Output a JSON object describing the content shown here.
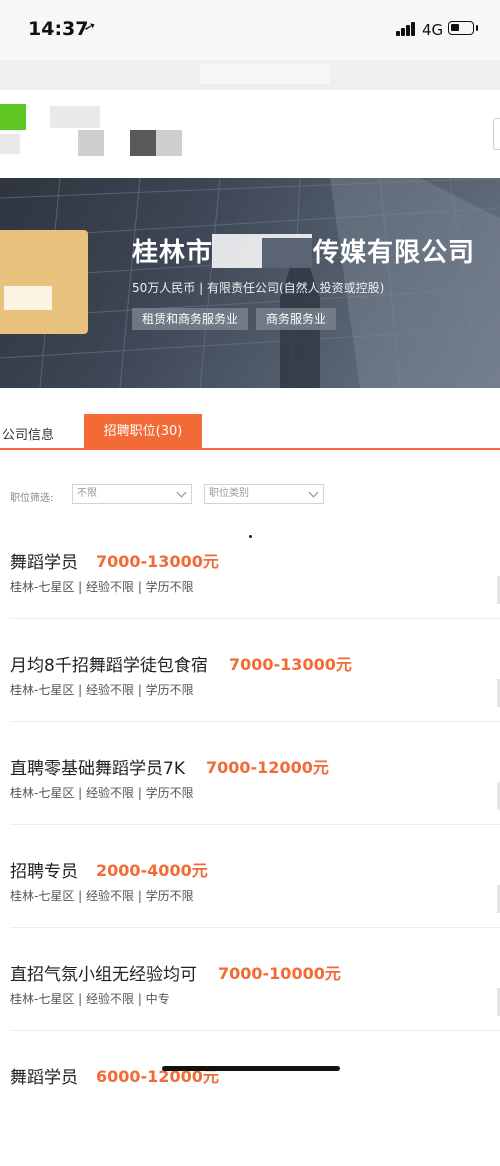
{
  "status_bar": {
    "time": "14:37",
    "location_glyph": "➚",
    "network": "4G",
    "battery_level": 0.4
  },
  "company": {
    "name_prefix": "桂林市",
    "name_suffix": "传媒有限公司",
    "meta": "50万人民币 | 有限责任公司(自然人投资或控股)",
    "tags": [
      "租赁和商务服务业",
      "商务服务业"
    ],
    "logo_color": "#e8c27c"
  },
  "tabs": {
    "info": "公司信息",
    "jobs": "招聘职位(30)"
  },
  "filters": {
    "label": "职位筛选:",
    "select1": "不限",
    "select2": "职位类别"
  },
  "jobs": [
    {
      "title": "舞蹈学员",
      "salary": "7000-13000元",
      "meta": "桂林-七星区 | 经验不限 | 学历不限"
    },
    {
      "title": "月均8千招舞蹈学徒包食宿",
      "salary": "7000-13000元",
      "meta": "桂林-七星区 | 经验不限 | 学历不限"
    },
    {
      "title": "直聘零基础舞蹈学员7K",
      "salary": "7000-12000元",
      "meta": "桂林-七星区 | 经验不限 | 学历不限"
    },
    {
      "title": "招聘专员",
      "salary": "2000-4000元",
      "meta": "桂林-七星区 | 经验不限 | 学历不限"
    },
    {
      "title": "直招气氛小组无经验均可",
      "salary": "7000-10000元",
      "meta": "桂林-七星区 | 经验不限 | 中专"
    },
    {
      "title": "舞蹈学员",
      "salary": "6000-12000元",
      "meta": ""
    }
  ],
  "colors": {
    "accent": "#f26a36",
    "banner": "#3d4654",
    "brand_green": "#5fc623"
  }
}
